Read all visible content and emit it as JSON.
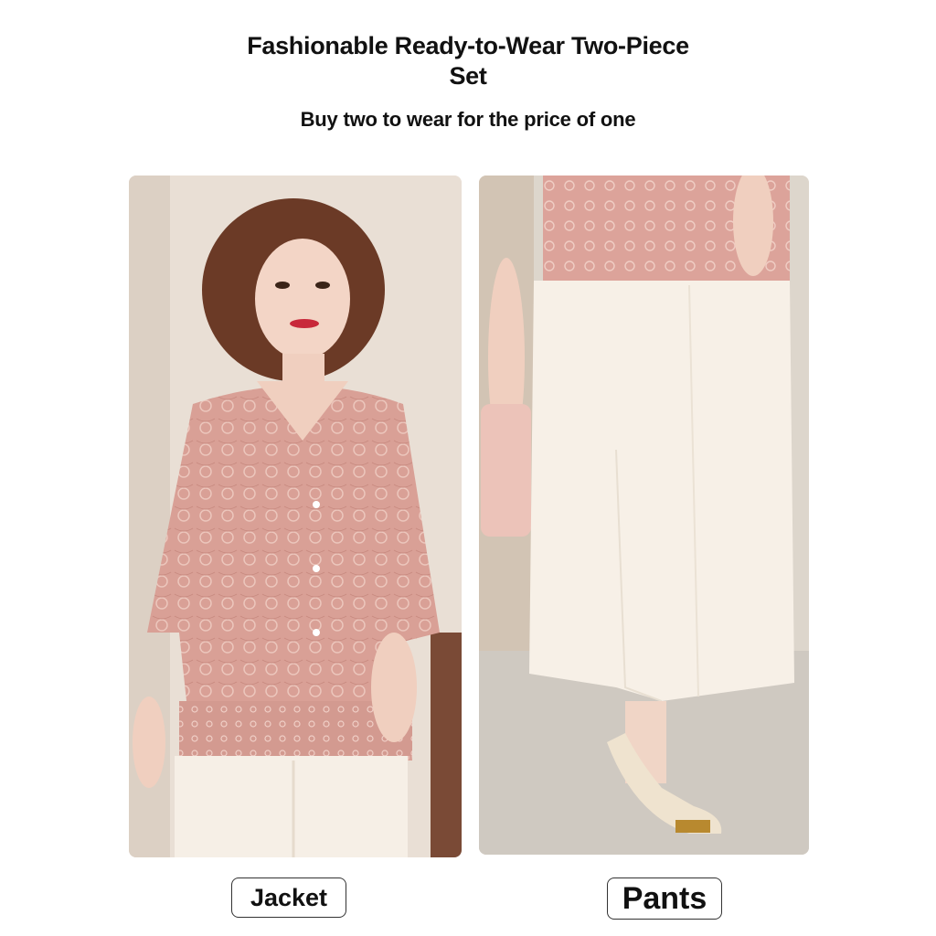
{
  "header": {
    "title_line1": "Fashionable Ready-to-Wear Two-Piece",
    "title_line2": "Set",
    "subtitle": "Buy two to wear for the price of one"
  },
  "photos": {
    "left": {
      "icon": "model-jacket-photo"
    },
    "right": {
      "icon": "model-pants-photo"
    }
  },
  "labels": {
    "jacket": "Jacket",
    "pants": "Pants"
  },
  "colors": {
    "background": "#ffffff",
    "blouse_pink": "#d9a096",
    "pants_cream": "#f6efe6",
    "wall": "#e7ddd3"
  }
}
